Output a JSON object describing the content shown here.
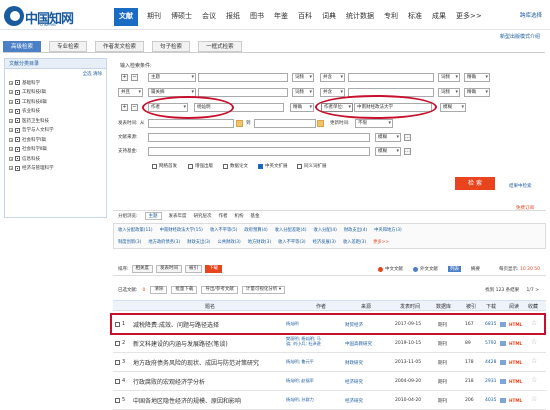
{
  "header": {
    "logo_text": "中国知网",
    "logo_sub": "cnki.net",
    "nav": [
      "文献",
      "期刊",
      "博硕士",
      "会议",
      "报纸",
      "图书",
      "年鉴",
      "百科",
      "词典",
      "统计数据",
      "专利",
      "标准",
      "成果",
      "更多>>"
    ],
    "right_link": "跨库选择",
    "right_link2": "新型出版模式介绍"
  },
  "tabs": [
    "高级检索",
    "专业检索",
    "作者发文检索",
    "句子检索",
    "一框式检索"
  ],
  "left_panel": {
    "title": "文献分类目录",
    "sub": "全选 清除",
    "categories": [
      "基础科学",
      "工程科技Ⅰ辑",
      "工程科技Ⅱ辑",
      "农业科技",
      "医药卫生科技",
      "哲学与人文科学",
      "社会科学Ⅰ辑",
      "社会科学Ⅱ辑",
      "信息科技",
      "经济与管理科学"
    ]
  },
  "search": {
    "title": "输入检索条件:",
    "row1_field": "主题",
    "row1_freq": "词频",
    "row1_and": "并含",
    "row1_freq2": "词频",
    "row1_precise": "精确",
    "row2_op": "并且",
    "row2_field": "篇关摘",
    "row2_freq": "词频",
    "row2_and": "并含",
    "row2_freq2": "词频",
    "row2_precise": "精确",
    "author_field": "作者",
    "author_value": "杨灿明",
    "author_precise": "精确",
    "org_field": "作者单位:",
    "org_value": "中南财经政法大学",
    "org_mode": "模糊",
    "time_label": "发表时间:",
    "time_from": "从",
    "time_to": "到",
    "update_label": "更新时间:",
    "update_value": "不限",
    "source_label": "文献来源:",
    "source_mode": "模糊",
    "fund_label": "支持基金:",
    "fund_mode": "模糊",
    "checks": [
      {
        "label": "网络首发",
        "on": false
      },
      {
        "label": "增强出版",
        "on": false
      },
      {
        "label": "数据论文",
        "on": false
      },
      {
        "label": "中英文扩展",
        "on": true
      },
      {
        "label": "同义词扩展",
        "on": false
      }
    ],
    "button": "检 索",
    "link_result": "结果中检索",
    "link_free": "免费订阅"
  },
  "group": {
    "label": "分组浏览:",
    "items": [
      "主题",
      "发表年度",
      "研究层次",
      "作者",
      "机构",
      "基金"
    ],
    "active_index": 0
  },
  "tags": [
    [
      "收入分配政策(11)",
      "中南财经政法大学(15)",
      "收入不平等(5)",
      "政府预算(4)",
      "收入分配差距(4)",
      "收入分配(4)",
      "财政支出(4)",
      "中央和地方(3)"
    ],
    [
      "制度创新(3)",
      "地方政府债务(3)",
      "财政支出(3)",
      "公共财政(3)",
      "地方财政(3)",
      "收入不平等(3)",
      "经济发展(3)",
      "收入差距(3)",
      "更多>>"
    ]
  ],
  "toolbar": {
    "sort_label": "排序:",
    "sort_items": [
      "相关度",
      "发表时间",
      "被引",
      "下载"
    ],
    "sort_active": 3,
    "lang": [
      "中文文献",
      "外文文献"
    ],
    "view_mode": [
      "列表",
      "摘要"
    ],
    "per_page_label": "每页显示:",
    "per_page": "10 20 50",
    "selected_label": "已选文献:",
    "selected_count": "0",
    "clear": "清除",
    "bulk": "批量下载",
    "export": "导出/参考文献",
    "visual": "计量可视化分析",
    "result_count": "找到 123 条结果",
    "page": "1/7 >"
  },
  "table": {
    "headers": [
      "题名",
      "作者",
      "来源",
      "发表时间",
      "数据库",
      "被引",
      "下载",
      "阅读",
      "收藏"
    ],
    "rows": [
      {
        "n": "1",
        "title": "减税降费:成效、问题与路径选择",
        "author": "杨灿明",
        "source": "财贸经济",
        "date": "2017-09-15",
        "db": "期刊",
        "ref": "167",
        "dl": "6815",
        "read": "HTML"
      },
      {
        "n": "2",
        "title": "新文科建设的内涵与发展路径(笔谈)",
        "author": "樊丽明; 杨灿明; 马骁; 刘小兵; 杜泽逊",
        "source": "中国高教研究",
        "date": "2019-10-15",
        "db": "期刊",
        "ref": "89",
        "dl": "5792",
        "read": "HTML"
      },
      {
        "n": "3",
        "title": "地方政府债务风险的现状、成因与防范对策研究",
        "author": "杨灿明; 鲁元平",
        "source": "财政研究",
        "date": "2013-11-05",
        "db": "期刊",
        "ref": "178",
        "dl": "4428",
        "read": "HTML"
      },
      {
        "n": "4",
        "title": "行政腐败的宏观经济学分析",
        "author": "杨灿明; 赵福军",
        "source": "经济研究",
        "date": "2004-09-20",
        "db": "期刊",
        "ref": "218",
        "dl": "2931",
        "read": "HTML"
      },
      {
        "n": "5",
        "title": "中国各地区隐性经济的规模、原因和影响",
        "author": "杨灿明; 孙群力",
        "source": "经济研究",
        "date": "2010-04-20",
        "db": "期刊",
        "ref": "206",
        "dl": "4035",
        "read": "HTML"
      }
    ]
  }
}
